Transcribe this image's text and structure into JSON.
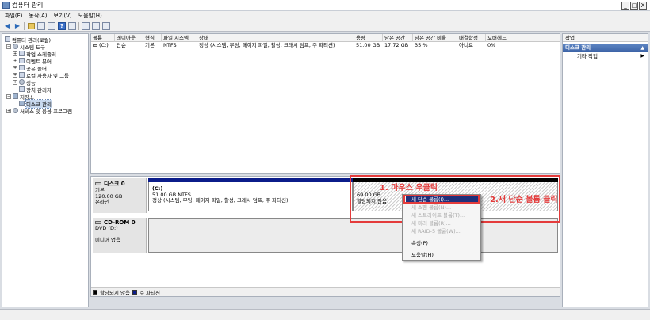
{
  "window": {
    "title": "컴퓨터 관리",
    "buttons": [
      "_",
      "□",
      "X"
    ]
  },
  "menu": [
    "파일(F)",
    "동작(A)",
    "보기(V)",
    "도움말(H)"
  ],
  "toolbar": {
    "icons": [
      "back-arrow-icon",
      "forward-arrow-icon",
      "up-folder-icon",
      "show-hide-tree-icon",
      "properties-icon",
      "help-icon",
      "refresh-icon",
      "export-icon",
      "tile-icon"
    ]
  },
  "tree": {
    "items": [
      {
        "label": "컴퓨터 관리(로컬)"
      },
      {
        "label": "시스템 도구"
      },
      {
        "label": "작업 스케줄러"
      },
      {
        "label": "이벤트 뷰어"
      },
      {
        "label": "공유 폴더"
      },
      {
        "label": "로컬 사용자 및 그룹"
      },
      {
        "label": "성능"
      },
      {
        "label": "장치 관리자"
      },
      {
        "label": "저장소"
      },
      {
        "label": "디스크 관리"
      },
      {
        "label": "서비스 및 응용 프로그램"
      }
    ]
  },
  "volumes": {
    "headers": [
      "볼륨",
      "레이아웃",
      "형식",
      "파일 시스템",
      "상태",
      "용량",
      "남은 공간",
      "남은 공간 비율",
      "내결함성",
      "오버헤드"
    ],
    "rows": [
      [
        "(C:)",
        "단순",
        "기본",
        "NTFS",
        "정상 (시스템, 부팅, 페이지 파일, 활성, 크래시 덤프, 주 파티션)",
        "51.00 GB",
        "17.72 GB",
        "35 %",
        "아니요",
        "0%"
      ]
    ]
  },
  "disks": [
    {
      "name": "디스크 0",
      "type": "기본",
      "size": "120.00 GB",
      "status": "온라인",
      "partitions": [
        {
          "name": "(C:)",
          "size": "51.00 GB NTFS",
          "status": "정상 (시스템, 부팅, 페이지 파일, 활성, 크래시 덤프, 주 파티션)"
        },
        {
          "name": "",
          "size": "69.00 GB",
          "status": "할당되지 않음"
        }
      ]
    },
    {
      "name": "CD-ROM 0",
      "type": "DVD (D:)",
      "status": "미디어 없음"
    }
  ],
  "legend": {
    "unallocated": "할당되지 않음",
    "primary": "주 파티션",
    "unallocated_color": "#000000",
    "primary_color": "#0b1c8a"
  },
  "actions": {
    "header": "작업",
    "selected": "디스크 관리",
    "items": [
      "기타 작업"
    ]
  },
  "context_menu": {
    "items": [
      {
        "label": "새 단순 볼륨(I)...",
        "state": "highlighted"
      },
      {
        "label": "새 스팬 볼륨(N)...",
        "state": "disabled"
      },
      {
        "label": "새 스트라이프 볼륨(T)...",
        "state": "disabled"
      },
      {
        "label": "새 미러 볼륨(R)...",
        "state": "disabled"
      },
      {
        "label": "새 RAID-5 볼륨(W)...",
        "state": "disabled"
      },
      {
        "label": "속성(P)",
        "state": "enabled"
      },
      {
        "label": "도움말(H)",
        "state": "enabled"
      }
    ]
  },
  "annotations": {
    "step1": "1. 마우스 우클릭",
    "step2": "2.새 단순 볼륨 클릭",
    "color": "#e43b3b"
  }
}
